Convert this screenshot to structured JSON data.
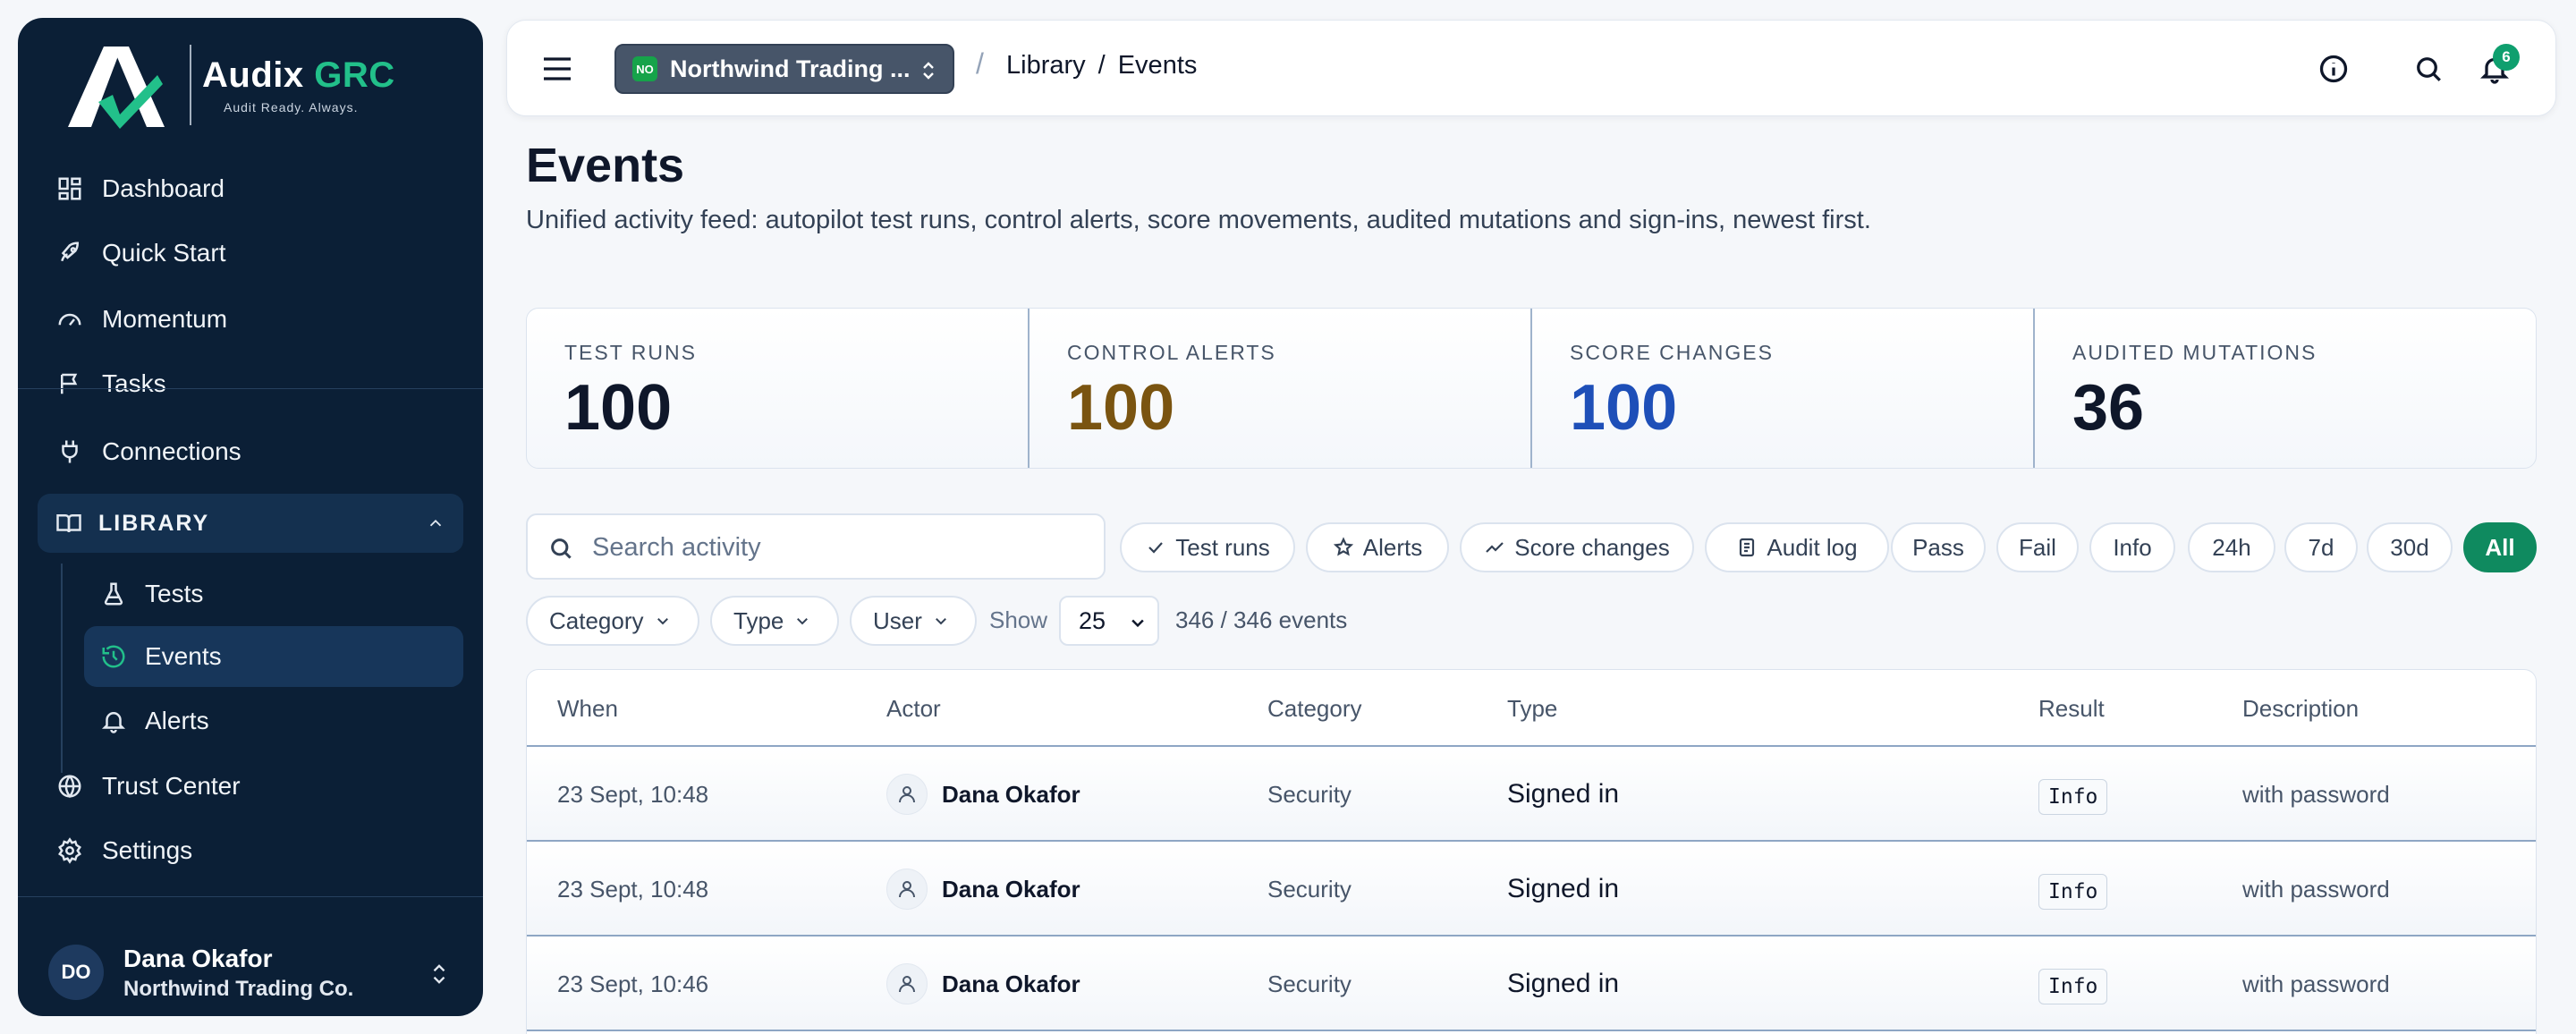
{
  "brand": {
    "name": "Audix",
    "name_accent": "GRC",
    "tagline": "Audit Ready. Always."
  },
  "sidebar": {
    "items": [
      {
        "label": "Dashboard",
        "icon": "dashboard-icon"
      },
      {
        "label": "Quick Start",
        "icon": "rocket-icon"
      },
      {
        "label": "Momentum",
        "icon": "gauge-icon"
      },
      {
        "label": "Tasks",
        "icon": "flag-icon"
      },
      {
        "label": "Connections",
        "icon": "plug-icon"
      }
    ],
    "library": {
      "label": "LIBRARY",
      "items": [
        {
          "label": "Tests",
          "icon": "flask-icon"
        },
        {
          "label": "Events",
          "icon": "history-icon",
          "active": true
        },
        {
          "label": "Alerts",
          "icon": "bell-icon"
        }
      ]
    },
    "bottom_items": [
      {
        "label": "Trust Center",
        "icon": "globe-icon"
      },
      {
        "label": "Settings",
        "icon": "gear-icon"
      }
    ],
    "user": {
      "initials": "DO",
      "name": "Dana Okafor",
      "org": "Northwind Trading Co."
    }
  },
  "topbar": {
    "org_badge": "NO",
    "org_name": "Northwind Trading ...",
    "breadcrumb": [
      "Library",
      "Events"
    ],
    "breadcrumb_sep": "/",
    "notification_count": "6"
  },
  "page": {
    "title": "Events",
    "description": "Unified activity feed: autopilot test runs, control alerts, score movements, audited mutations and sign-ins, newest first."
  },
  "stats": [
    {
      "label": "TEST RUNS",
      "value": "100",
      "color": "#0f172a"
    },
    {
      "label": "CONTROL ALERTS",
      "value": "100",
      "color": "#7a5410"
    },
    {
      "label": "SCORE CHANGES",
      "value": "100",
      "color": "#1e4fb8"
    },
    {
      "label": "AUDITED MUTATIONS",
      "value": "36",
      "color": "#0f172a"
    }
  ],
  "filters": {
    "search_placeholder": "Search activity",
    "chips": [
      "Test runs",
      "Alerts",
      "Score changes",
      "Audit log",
      "Pass",
      "Fail",
      "Info",
      "24h",
      "7d",
      "30d",
      "All"
    ],
    "active_chip": "All",
    "dropdowns": [
      "Category",
      "Type",
      "User"
    ],
    "show_label": "Show",
    "page_size": "25",
    "count_text": "346 / 346 events"
  },
  "table": {
    "columns": [
      "When",
      "Actor",
      "Category",
      "Type",
      "Result",
      "Description"
    ],
    "rows": [
      {
        "when": "23 Sept, 10:48",
        "actor": "Dana Okafor",
        "category": "Security",
        "type": "Signed in",
        "result": "Info",
        "description": "with password"
      },
      {
        "when": "23 Sept, 10:48",
        "actor": "Dana Okafor",
        "category": "Security",
        "type": "Signed in",
        "result": "Info",
        "description": "with password"
      },
      {
        "when": "23 Sept, 10:46",
        "actor": "Dana Okafor",
        "category": "Security",
        "type": "Signed in",
        "result": "Info",
        "description": "with password"
      }
    ]
  }
}
